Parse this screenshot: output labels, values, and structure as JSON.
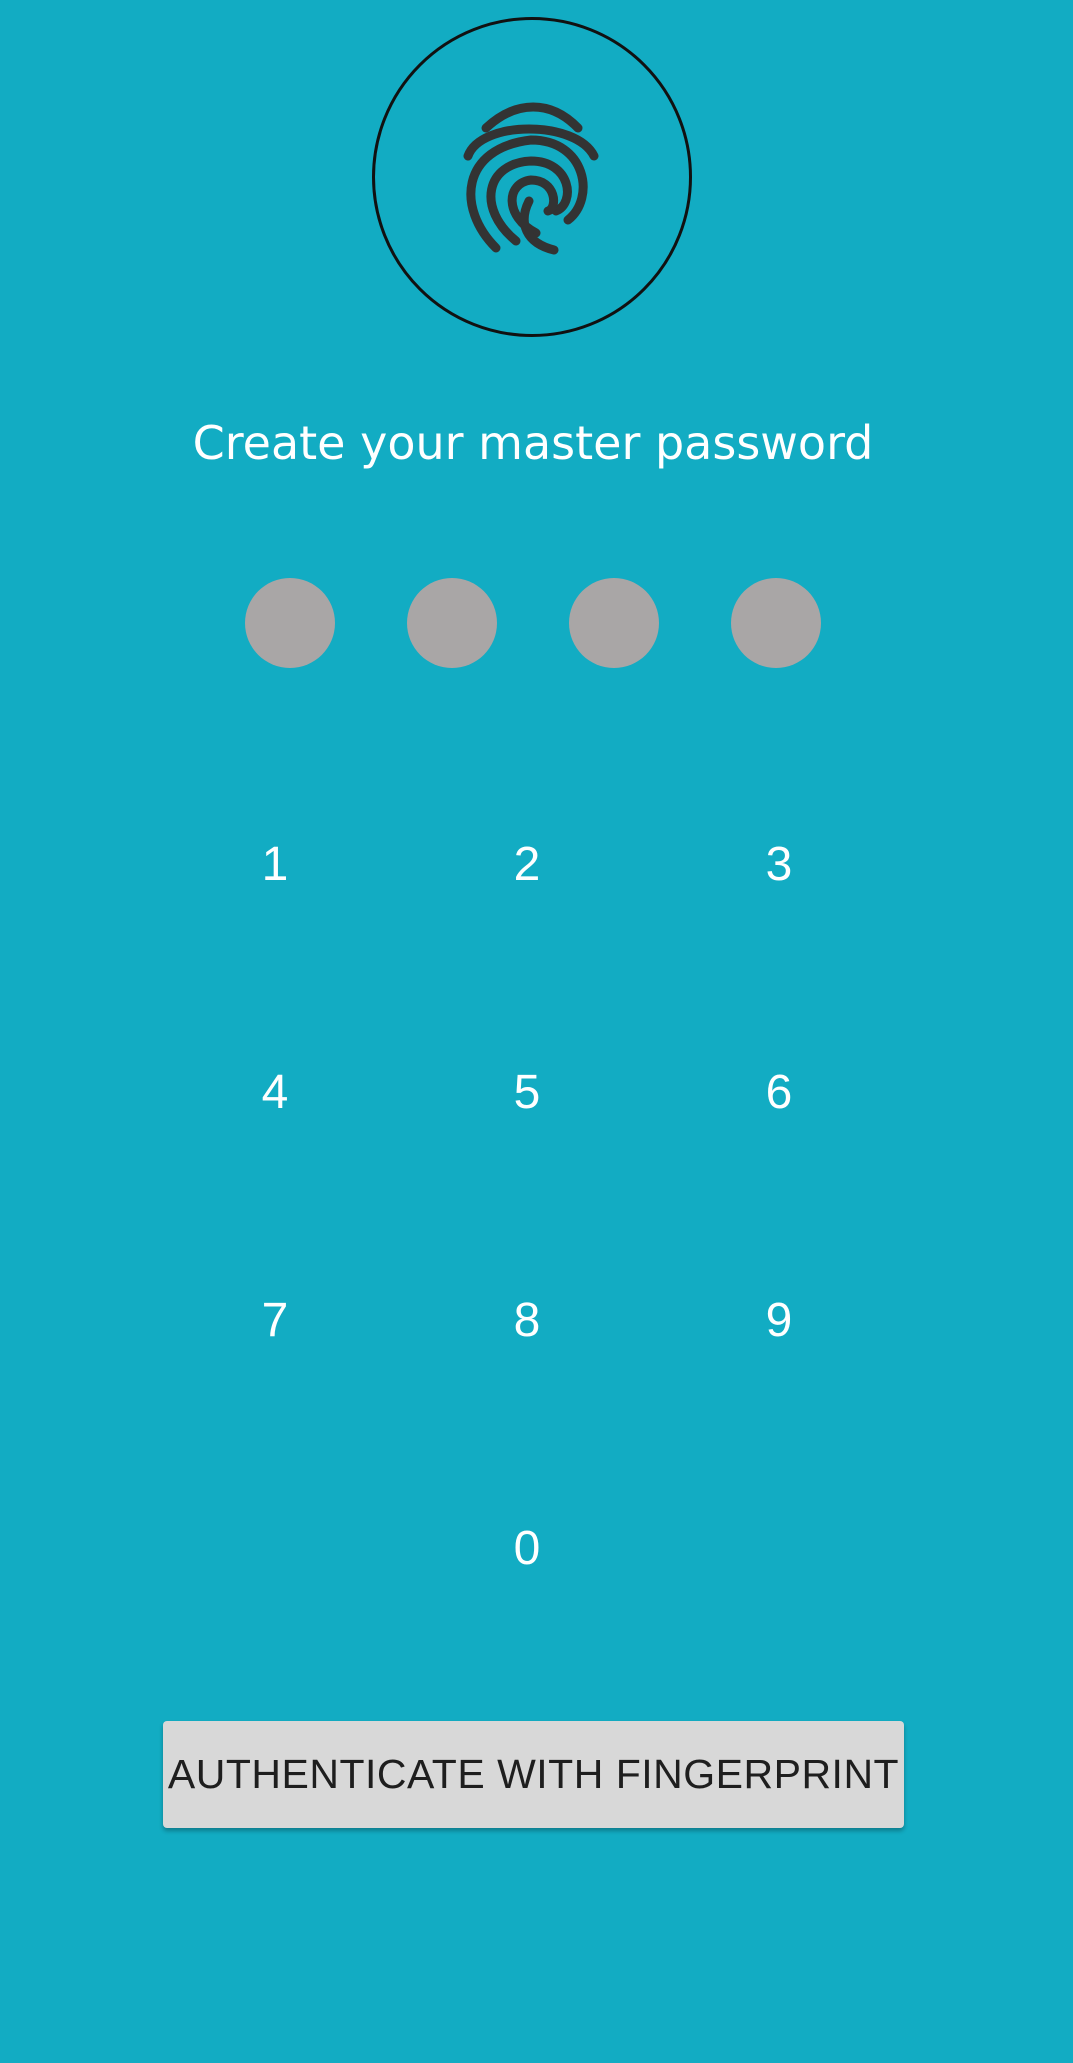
{
  "colors": {
    "background": "#12acc3",
    "pin_dot": "#a9a6a6",
    "button_bg": "#d8d8d8",
    "icon_stroke": "#333333"
  },
  "header": {
    "icon": "fingerprint-icon",
    "title": "Create your master password"
  },
  "pin": {
    "length": 4,
    "entered": 0
  },
  "keypad": {
    "keys": [
      "1",
      "2",
      "3",
      "4",
      "5",
      "6",
      "7",
      "8",
      "9",
      "0"
    ]
  },
  "auth_button": {
    "label": "AUTHENTICATE WITH FINGERPRINT"
  }
}
